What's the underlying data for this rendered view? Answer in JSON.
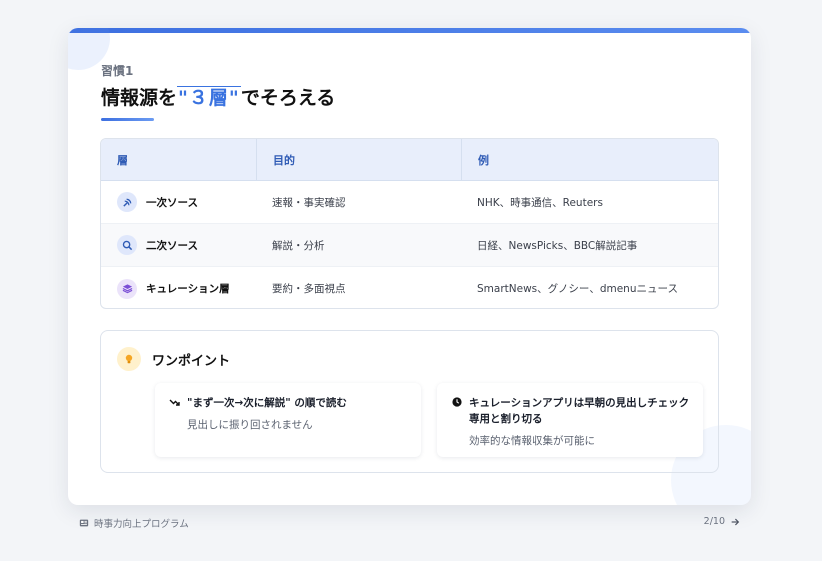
{
  "header": {
    "eyebrow": "習慣1",
    "title_before": "情報源を",
    "title_highlight": "\"３層\"",
    "title_after": "でそろえる"
  },
  "table": {
    "columns": [
      "層",
      "目的",
      "例"
    ],
    "rows": [
      {
        "icon": "satellite-signal-icon",
        "layer": "一次ソース",
        "purpose": "速報・事実確認",
        "examples": "NHK、時事通信、Reuters"
      },
      {
        "icon": "magnifier-icon",
        "layer": "二次ソース",
        "purpose": "解説・分析",
        "examples": "日経、NewsPicks、BBC解説記事"
      },
      {
        "icon": "layers-icon",
        "layer": "キュレーション層",
        "purpose": "要約・多面視点",
        "examples": "SmartNews、グノシー、dmenuニュース"
      }
    ]
  },
  "tip": {
    "title": "ワンポイント",
    "items": [
      {
        "icon": "trend-arrow-icon",
        "text": "\"まず一次→次に解説\" の順で読む",
        "sub": "見出しに振り回されません"
      },
      {
        "icon": "clock-icon",
        "text": "キュレーションアプリは早朝の見出しチェック専用と割り切る",
        "sub": "効率的な情報収集が可能に"
      }
    ]
  },
  "footer": {
    "program": "時事力向上プログラム",
    "page": "2/10"
  },
  "colors": {
    "accent": "#3a73e0",
    "header_bg": "#e8eefb",
    "tip_bulb": "#f5a623"
  }
}
